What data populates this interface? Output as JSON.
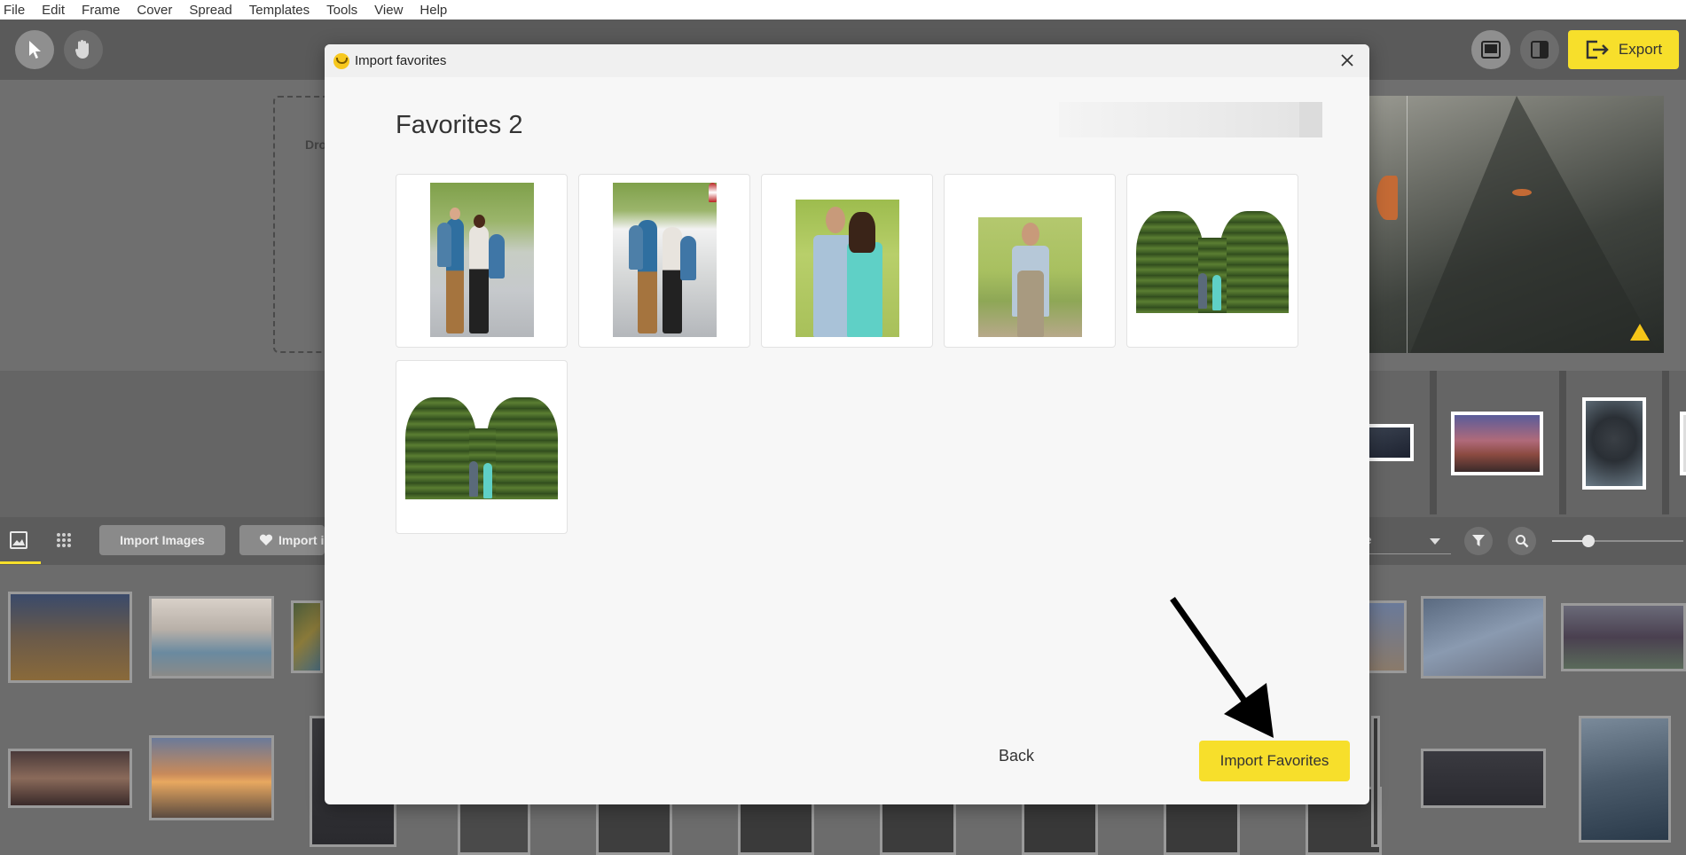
{
  "menu": [
    "File",
    "Edit",
    "Frame",
    "Cover",
    "Spread",
    "Templates",
    "Tools",
    "View",
    "Help"
  ],
  "toolbar": {
    "select_icon": "cursor-icon",
    "pan_icon": "hand-icon",
    "layout_icon_1": "single-page-icon",
    "layout_icon_2": "sidebar-layout-icon",
    "export_label": "Export"
  },
  "workspace": {
    "drop_text": "Dro"
  },
  "lower_bar": {
    "import_images_label": "Import Images",
    "import_favorites_label": "Import i",
    "sort_label": "ne"
  },
  "modal": {
    "title": "Import favorites",
    "heading": "Favorites 2",
    "back_label": "Back",
    "import_label": "Import Favorites"
  },
  "colors": {
    "accent": "#f7df2b",
    "toolbar": "#5a5a5a",
    "modal_bg": "#f7f7f7"
  }
}
